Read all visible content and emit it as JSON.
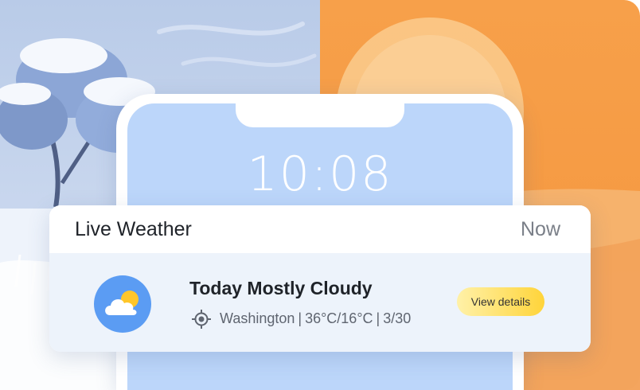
{
  "lock_screen": {
    "time": "10:08"
  },
  "weather_card": {
    "title": "Live Weather",
    "timestamp": "Now",
    "icon": "partly-cloudy-icon",
    "headline": "Today Mostly Cloudy",
    "location_icon": "location-target-icon",
    "location": "Washington",
    "temperature": "36°C/16°C",
    "date": "3/30",
    "separator": "|",
    "details_label": "View details"
  },
  "colors": {
    "winter_sky": "#b9cbe8",
    "summer_sky": "#f7a04a",
    "phone_screen": "#bcd6fa",
    "card_body": "#edf3fb",
    "weather_icon_bg": "#5b9cf3",
    "sun": "#ffc629",
    "button_gradient": [
      "#fff1a8",
      "#ffd43a"
    ]
  }
}
